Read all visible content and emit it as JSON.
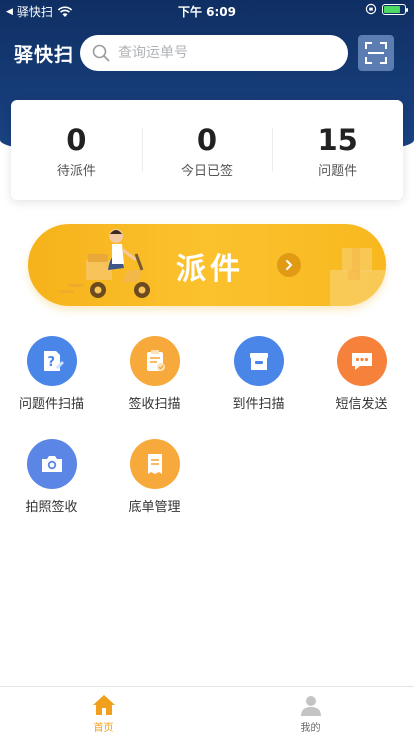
{
  "status_bar": {
    "back_app": "驿快扫",
    "time": "下午 6:09"
  },
  "header": {
    "app_title": "驿快扫",
    "search_placeholder": "查询运单号",
    "icons": {
      "search": "search-icon",
      "scan": "scan-icon"
    }
  },
  "stats": [
    {
      "value": "0",
      "label": "待派件"
    },
    {
      "value": "0",
      "label": "今日已签"
    },
    {
      "value": "15",
      "label": "问题件"
    }
  ],
  "dispatch": {
    "label": "派件",
    "icon": "chevron-right-icon"
  },
  "functions": [
    {
      "label": "问题件扫描",
      "icon": "question-doc-icon",
      "color": "#4a86e8"
    },
    {
      "label": "签收扫描",
      "icon": "clipboard-check-icon",
      "color": "#f7a93b"
    },
    {
      "label": "到件扫描",
      "icon": "box-icon",
      "color": "#4a86e8"
    },
    {
      "label": "短信发送",
      "icon": "message-icon",
      "color": "#f5813a"
    },
    {
      "label": "拍照签收",
      "icon": "camera-icon",
      "color": "#5b86e5"
    },
    {
      "label": "底单管理",
      "icon": "receipt-icon",
      "color": "#f7a93b"
    }
  ],
  "tabbar": [
    {
      "label": "首页",
      "icon": "home-icon",
      "active": true
    },
    {
      "label": "我的",
      "icon": "user-icon",
      "active": false
    }
  ],
  "colors": {
    "header_navy": "#163c78",
    "accent_orange": "#f7a93b",
    "dispatch_yellow": "#fbc22e",
    "tab_active": "#f0a01c",
    "tab_inactive": "#666666"
  }
}
